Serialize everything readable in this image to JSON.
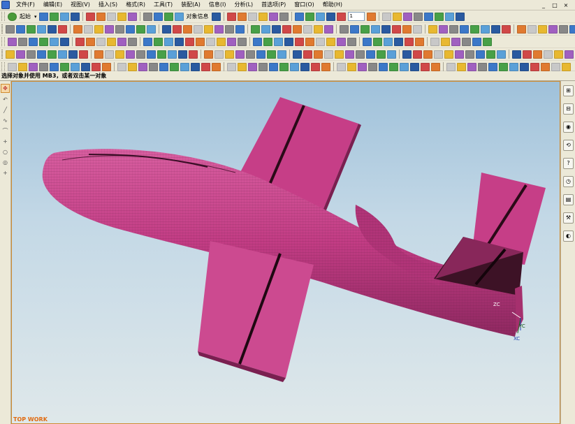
{
  "menubar": {
    "items": [
      "文件(F)",
      "编辑(E)",
      "视图(V)",
      "插入(S)",
      "格式(R)",
      "工具(T)",
      "装配(A)",
      "信息(I)",
      "分析(L)",
      "首选项(P)",
      "窗口(O)",
      "帮助(H)"
    ],
    "window_controls": [
      "_",
      "□",
      "×"
    ]
  },
  "toolbar": {
    "start_label": "起始",
    "object_info_label": "对象信息",
    "layer_value": "1"
  },
  "status": {
    "prompt": "选择对象并使用 MB3，或者双击某一对象"
  },
  "viewport": {
    "view_name": "TOP WORK",
    "axis_labels": {
      "zc": "ZC",
      "yc": "YC",
      "xc": "XC"
    },
    "model_color": "#c83c86"
  },
  "colors": {
    "highlight_border": "#d08c30",
    "menubar_bg": "#ece9d8"
  }
}
